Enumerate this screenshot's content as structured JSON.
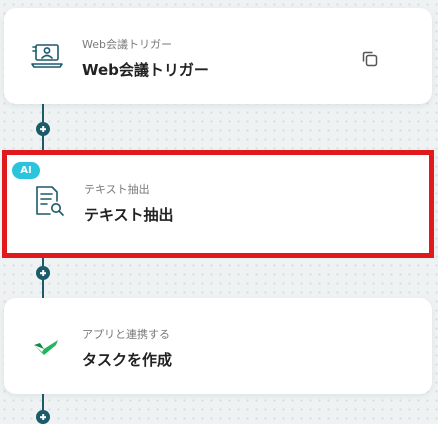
{
  "colors": {
    "connector": "#1c5a6a",
    "selection_border": "#e0191c",
    "ai_badge": "#2ac4dd",
    "check_mark": "#1fb65a"
  },
  "flow": {
    "steps": [
      {
        "subtitle": "Web会議トリガー",
        "title": "Web会議トリガー",
        "icon": "web-meeting-icon",
        "action_icon": "copy-icon"
      },
      {
        "badge": "AI",
        "subtitle": "テキスト抽出",
        "title": "テキスト抽出",
        "icon": "document-search-icon",
        "selected": true
      },
      {
        "subtitle": "アプリと連携する",
        "title": "タスクを作成",
        "icon": "check-icon"
      }
    ],
    "add_step_icon": "plus-circle-icon"
  }
}
